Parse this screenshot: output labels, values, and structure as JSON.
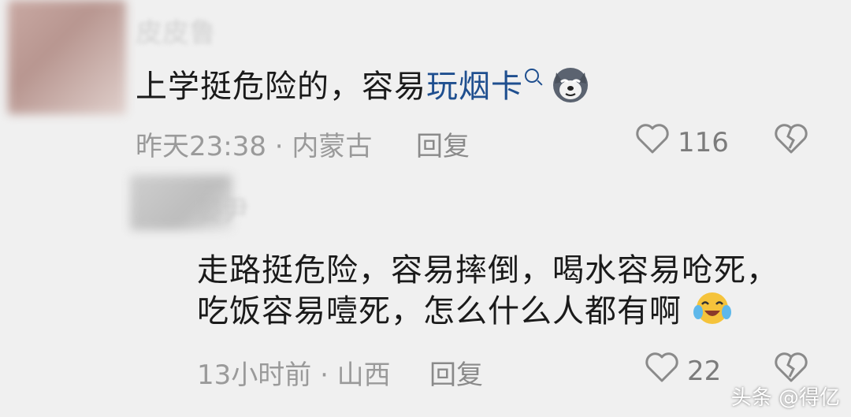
{
  "comments": [
    {
      "username": "皮皮鲁",
      "text_plain": "上学挺危险的，容易",
      "text_link": "玩烟卡",
      "emoji": "dog-emoji",
      "meta": "昨天23:38 · 内蒙古",
      "reply": "回复",
      "likes": "116"
    },
    {
      "username": "晏尹",
      "line1": "走路挺危险，容易摔倒，喝水容易呛死，",
      "line2": "吃饭容易噎死，怎么什么人都有啊",
      "emoji": "crying-laughing-emoji",
      "meta": "13小时前 · 山西",
      "reply": "回复",
      "likes": "22"
    }
  ],
  "watermark": "头条 @得亿",
  "colors": {
    "link": "#1f4f8f",
    "text": "#1a1a1a",
    "meta": "#9a9a9a",
    "background": "#f0f0f0"
  }
}
